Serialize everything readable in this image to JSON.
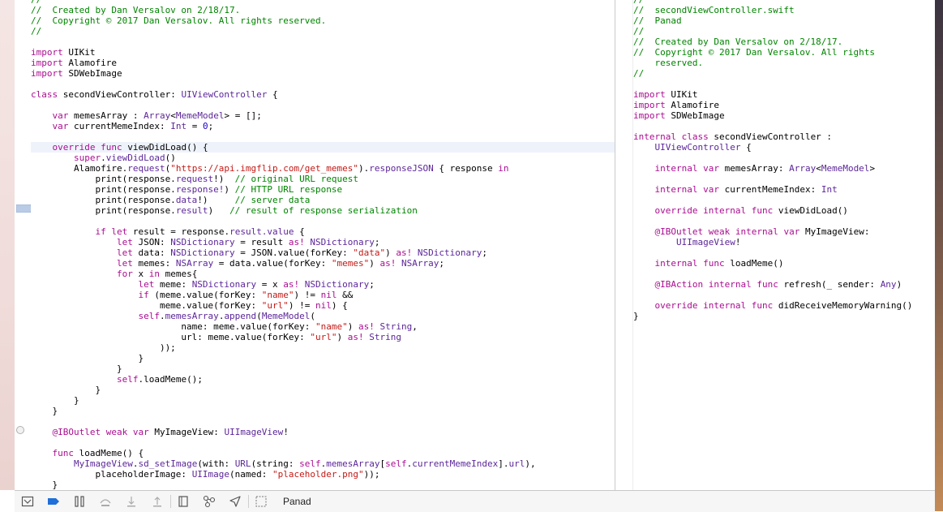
{
  "left_strip": {
    "marks": [
      "o",
      "s",
      "3",
      "s",
      "s"
    ]
  },
  "editor": {
    "lines": [
      {
        "t": "//",
        "c": "cm"
      },
      {
        "t": "//  Created by Dan Versalov on 2/18/17.",
        "c": "cm"
      },
      {
        "t": "//  Copyright © 2017 Dan Versalov. All rights reserved.",
        "c": "cm"
      },
      {
        "t": "//",
        "c": "cm"
      },
      {
        "t": ""
      },
      {
        "t": "import UIKit",
        "k": [
          "import"
        ]
      },
      {
        "t": "import Alamofire",
        "k": [
          "import"
        ]
      },
      {
        "t": "import SDWebImage",
        "k": [
          "import"
        ]
      },
      {
        "t": ""
      },
      {
        "t": "class secondViewController: UIViewController {",
        "k": [
          "class"
        ],
        "y": [
          "UIViewController"
        ]
      },
      {
        "t": ""
      },
      {
        "t": "    var memesArray : Array<MemeModel> = [];",
        "k": [
          "var"
        ],
        "y": [
          "Array",
          "MemeModel"
        ]
      },
      {
        "t": "    var currentMemeIndex: Int = 0;",
        "k": [
          "var"
        ],
        "y": [
          "Int"
        ],
        "n": [
          "0"
        ]
      },
      {
        "t": ""
      },
      {
        "t": "    override func viewDidLoad() {",
        "k": [
          "override",
          "func"
        ],
        "current": true
      },
      {
        "t": "        super.viewDidLoad()",
        "k": [
          "super"
        ],
        "y": [
          "viewDidLoad"
        ]
      },
      {
        "t": "        Alamofire.request(\"https://api.imgflip.com/get_memes\").responseJSON { response in",
        "s": [
          "\"https://api.imgflip.com/get_memes\""
        ],
        "y": [
          "request",
          "responseJSON"
        ],
        "k": [
          "in"
        ]
      },
      {
        "t": "            print(response.request!)  // original URL request",
        "y": [
          "request"
        ],
        "m": "// original URL request"
      },
      {
        "t": "            print(response.response!) // HTTP URL response",
        "y": [
          "response!"
        ],
        "m": "// HTTP URL response"
      },
      {
        "t": "            print(response.data!)     // server data",
        "y": [
          "data"
        ],
        "m": "// server data"
      },
      {
        "t": "            print(response.result)   // result of response serialization",
        "y": [
          "result"
        ],
        "m": "// result of response serialization"
      },
      {
        "t": ""
      },
      {
        "t": "            if let result = response.result.value {",
        "k": [
          "if",
          "let"
        ],
        "y": [
          "result.value"
        ]
      },
      {
        "t": "                let JSON: NSDictionary = result as! NSDictionary;",
        "k": [
          "let",
          "as!"
        ],
        "y": [
          "NSDictionary"
        ]
      },
      {
        "t": "                let data: NSDictionary = JSON.value(forKey: \"data\") as! NSDictionary;",
        "k": [
          "let",
          "as!"
        ],
        "y": [
          "NSDictionary"
        ],
        "s": [
          "\"data\""
        ]
      },
      {
        "t": "                let memes: NSArray = data.value(forKey: \"memes\") as! NSArray;",
        "k": [
          "let",
          "as!"
        ],
        "y": [
          "NSArray"
        ],
        "s": [
          "\"memes\""
        ]
      },
      {
        "t": "                for x in memes{",
        "k": [
          "for",
          "in"
        ]
      },
      {
        "t": "                    let meme: NSDictionary = x as! NSDictionary;",
        "k": [
          "let",
          "as!"
        ],
        "y": [
          "NSDictionary"
        ]
      },
      {
        "t": "                    if (meme.value(forKey: \"name\") != nil &&",
        "k": [
          "if",
          "nil"
        ],
        "s": [
          "\"name\""
        ]
      },
      {
        "t": "                        meme.value(forKey: \"url\") != nil) {",
        "k": [
          "nil"
        ],
        "s": [
          "\"url\""
        ]
      },
      {
        "t": "                    self.memesArray.append(MemeModel(",
        "k": [
          "self"
        ],
        "y": [
          "memesArray",
          "append",
          "MemeModel"
        ]
      },
      {
        "t": "                            name: meme.value(forKey: \"name\") as! String,",
        "k": [
          "as!"
        ],
        "y": [
          "String"
        ],
        "s": [
          "\"name\""
        ]
      },
      {
        "t": "                            url: meme.value(forKey: \"url\") as! String",
        "k": [
          "as!"
        ],
        "y": [
          "String"
        ],
        "s": [
          "\"url\""
        ]
      },
      {
        "t": "                        ));"
      },
      {
        "t": "                    }"
      },
      {
        "t": "                }"
      },
      {
        "t": "                self.loadMeme();",
        "k": [
          "self"
        ]
      },
      {
        "t": "            }"
      },
      {
        "t": "        }"
      },
      {
        "t": "    }"
      },
      {
        "t": ""
      },
      {
        "t": "    @IBOutlet weak var MyImageView: UIImageView!",
        "k": [
          "@IBOutlet",
          "weak",
          "var"
        ],
        "y": [
          "UIImageView"
        ]
      },
      {
        "t": ""
      },
      {
        "t": "    func loadMeme() {",
        "k": [
          "func"
        ]
      },
      {
        "t": "        MyImageView.sd_setImage(with: URL(string: self.memesArray[self.currentMemeIndex].url),",
        "k": [
          "self"
        ],
        "y": [
          "MyImageView",
          "sd_setImage",
          "URL",
          "memesArray",
          "currentMemeIndex",
          "url"
        ]
      },
      {
        "t": "            placeholderImage: UIImage(named: \"placeholder.png\"));",
        "y": [
          "UIImage"
        ],
        "s": [
          "\"placeholder.png\""
        ]
      },
      {
        "t": "    }"
      }
    ]
  },
  "assistant": {
    "lines": [
      {
        "t": "//",
        "c": "cm"
      },
      {
        "t": "//  secondViewController.swift",
        "c": "cm"
      },
      {
        "t": "//  Panad",
        "c": "cm"
      },
      {
        "t": "//",
        "c": "cm"
      },
      {
        "t": "//  Created by Dan Versalov on 2/18/17.",
        "c": "cm"
      },
      {
        "t": "//  Copyright © 2017 Dan Versalov. All rights",
        "c": "cm"
      },
      {
        "t": "    reserved.",
        "c": "cm"
      },
      {
        "t": "//",
        "c": "cm"
      },
      {
        "t": ""
      },
      {
        "t": "import UIKit",
        "k": [
          "import"
        ]
      },
      {
        "t": "import Alamofire",
        "k": [
          "import"
        ]
      },
      {
        "t": "import SDWebImage",
        "k": [
          "import"
        ]
      },
      {
        "t": ""
      },
      {
        "t": "internal class secondViewController :",
        "k": [
          "internal",
          "class"
        ]
      },
      {
        "t": "    UIViewController {",
        "y": [
          "UIViewController"
        ]
      },
      {
        "t": ""
      },
      {
        "t": "    internal var memesArray: Array<MemeModel>",
        "k": [
          "internal",
          "var"
        ],
        "y": [
          "Array",
          "MemeModel"
        ]
      },
      {
        "t": ""
      },
      {
        "t": "    internal var currentMemeIndex: Int",
        "k": [
          "internal",
          "var"
        ],
        "y": [
          "Int"
        ]
      },
      {
        "t": ""
      },
      {
        "t": "    override internal func viewDidLoad()",
        "k": [
          "override",
          "internal",
          "func"
        ]
      },
      {
        "t": ""
      },
      {
        "t": "    @IBOutlet weak internal var MyImageView:",
        "k": [
          "@IBOutlet",
          "weak",
          "internal",
          "var"
        ]
      },
      {
        "t": "        UIImageView!",
        "y": [
          "UIImageView"
        ]
      },
      {
        "t": ""
      },
      {
        "t": "    internal func loadMeme()",
        "k": [
          "internal",
          "func"
        ]
      },
      {
        "t": ""
      },
      {
        "t": "    @IBAction internal func refresh(_ sender: Any)",
        "k": [
          "@IBAction",
          "internal",
          "func"
        ],
        "y": [
          "Any"
        ]
      },
      {
        "t": ""
      },
      {
        "t": "    override internal func didReceiveMemoryWarning()",
        "k": [
          "override",
          "internal",
          "func"
        ]
      },
      {
        "t": "}"
      }
    ]
  },
  "debug_bar": {
    "scheme": "Panad",
    "icons": [
      "hide-debug-area-icon",
      "breakpoints-toggle-icon",
      "pause-icon",
      "step-over-icon",
      "step-into-icon",
      "step-out-icon",
      "view-hierarchy-icon",
      "memory-graph-icon",
      "simulate-location-icon",
      "scheme-target-icon"
    ],
    "colors": {
      "breakpoint": "#1e6fd9",
      "toolbar_bg": "#f6f6f6"
    }
  }
}
